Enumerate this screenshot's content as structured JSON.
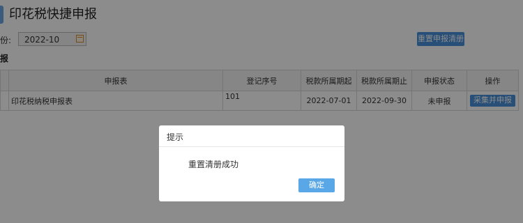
{
  "header": {
    "title": "印花税快捷申报"
  },
  "filter": {
    "period_label": "份:",
    "period_value": "2022-10",
    "reset_button": "重置申报清册"
  },
  "section": {
    "label": "报"
  },
  "table": {
    "columns": [
      "",
      "申报表",
      "登记序号",
      "税款所属期起",
      "税款所属期止",
      "申报状态",
      "操作"
    ],
    "rows": [
      {
        "name": "印花税纳税申报表",
        "reg_prefix": "101",
        "start": "2022-07-01",
        "end": "2022-09-30",
        "status": "未申报",
        "action": "采集并申报"
      }
    ]
  },
  "dialog": {
    "title": "提示",
    "message": "重置清册成功",
    "confirm": "确定"
  }
}
